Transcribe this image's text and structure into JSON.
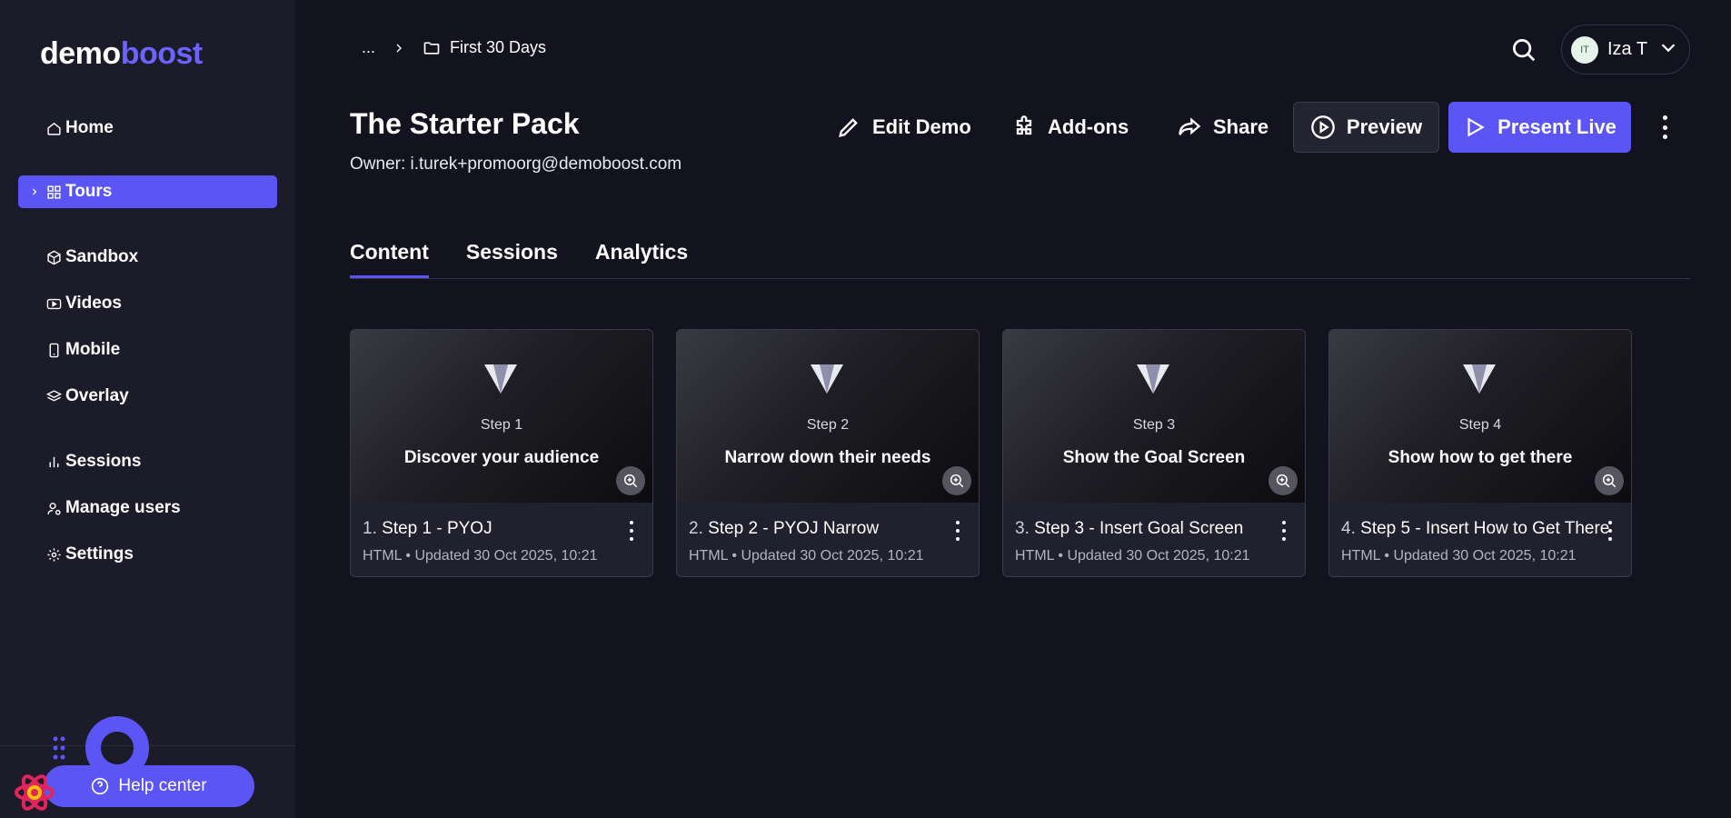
{
  "brand": {
    "part1": "demo",
    "part2": "boost"
  },
  "sidebar": {
    "items": [
      {
        "label": "Home",
        "icon": "home-icon"
      },
      {
        "label": "Tours",
        "icon": "grid-icon",
        "active": true
      },
      {
        "label": "Sandbox",
        "icon": "cube-icon"
      },
      {
        "label": "Videos",
        "icon": "video-icon"
      },
      {
        "label": "Mobile",
        "icon": "mobile-icon"
      },
      {
        "label": "Overlay",
        "icon": "layers-icon"
      },
      {
        "label": "Sessions",
        "icon": "bar-chart-icon"
      },
      {
        "label": "Manage users",
        "icon": "user-icon"
      },
      {
        "label": "Settings",
        "icon": "gear-icon"
      }
    ],
    "help_label": "Help center"
  },
  "breadcrumb": {
    "ellipsis": "...",
    "current": "First 30 Days"
  },
  "user": {
    "initials": "IT",
    "name": "Iza T"
  },
  "page": {
    "title": "The Starter Pack",
    "owner": "Owner: i.turek+promoorg@demoboost.com"
  },
  "actions": {
    "edit": "Edit Demo",
    "addons": "Add-ons",
    "share": "Share",
    "preview": "Preview",
    "present": "Present Live"
  },
  "tabs": [
    {
      "label": "Content",
      "active": true
    },
    {
      "label": "Sessions"
    },
    {
      "label": "Analytics"
    }
  ],
  "cards": [
    {
      "step": "Step 1",
      "headline": "Discover your audience",
      "num": "1.",
      "title": "Step 1 - PYOJ",
      "meta": "HTML • Updated 30 Oct 2025, 10:21"
    },
    {
      "step": "Step 2",
      "headline": "Narrow down their needs",
      "num": "2.",
      "title": "Step 2 - PYOJ Narrow",
      "meta": "HTML • Updated 30 Oct 2025, 10:21"
    },
    {
      "step": "Step 3",
      "headline": "Show the Goal Screen",
      "num": "3.",
      "title": "Step 3 - Insert Goal Screen",
      "meta": "HTML • Updated 30 Oct 2025, 10:21"
    },
    {
      "step": "Step 4",
      "headline": "Show how to get there",
      "num": "4.",
      "title": "Step 5 - Insert How to Get There",
      "meta": "HTML • Updated 30 Oct 2025, 10:21"
    }
  ],
  "colors": {
    "accent": "#5c55f5",
    "background": "#13131f",
    "sidebar": "#1b1b29"
  }
}
